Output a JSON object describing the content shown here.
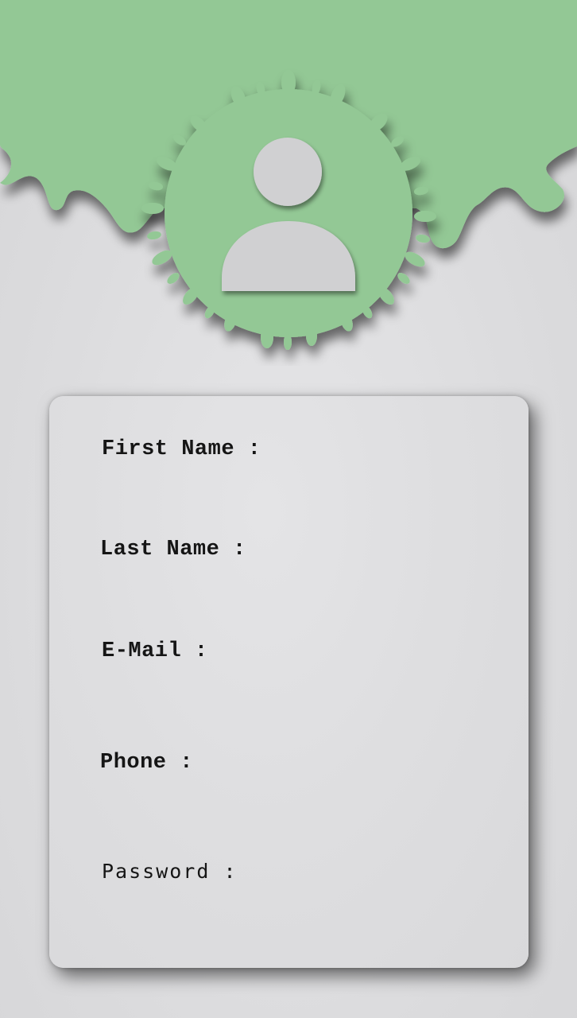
{
  "colors": {
    "accent_green": "#93c895",
    "background": "#dedee0",
    "card": "#dededf",
    "avatar_fill": "#d0d0d2",
    "label_text": "#151515"
  },
  "header": {
    "avatar_icon": "user-avatar-icon"
  },
  "form": {
    "first_name": {
      "label": "First Name :",
      "value": ""
    },
    "last_name": {
      "label": "Last Name :",
      "value": ""
    },
    "email": {
      "label": "E-Mail :",
      "value": ""
    },
    "phone": {
      "label": "Phone :",
      "value": ""
    },
    "password": {
      "label": "Password :",
      "value": ""
    }
  }
}
